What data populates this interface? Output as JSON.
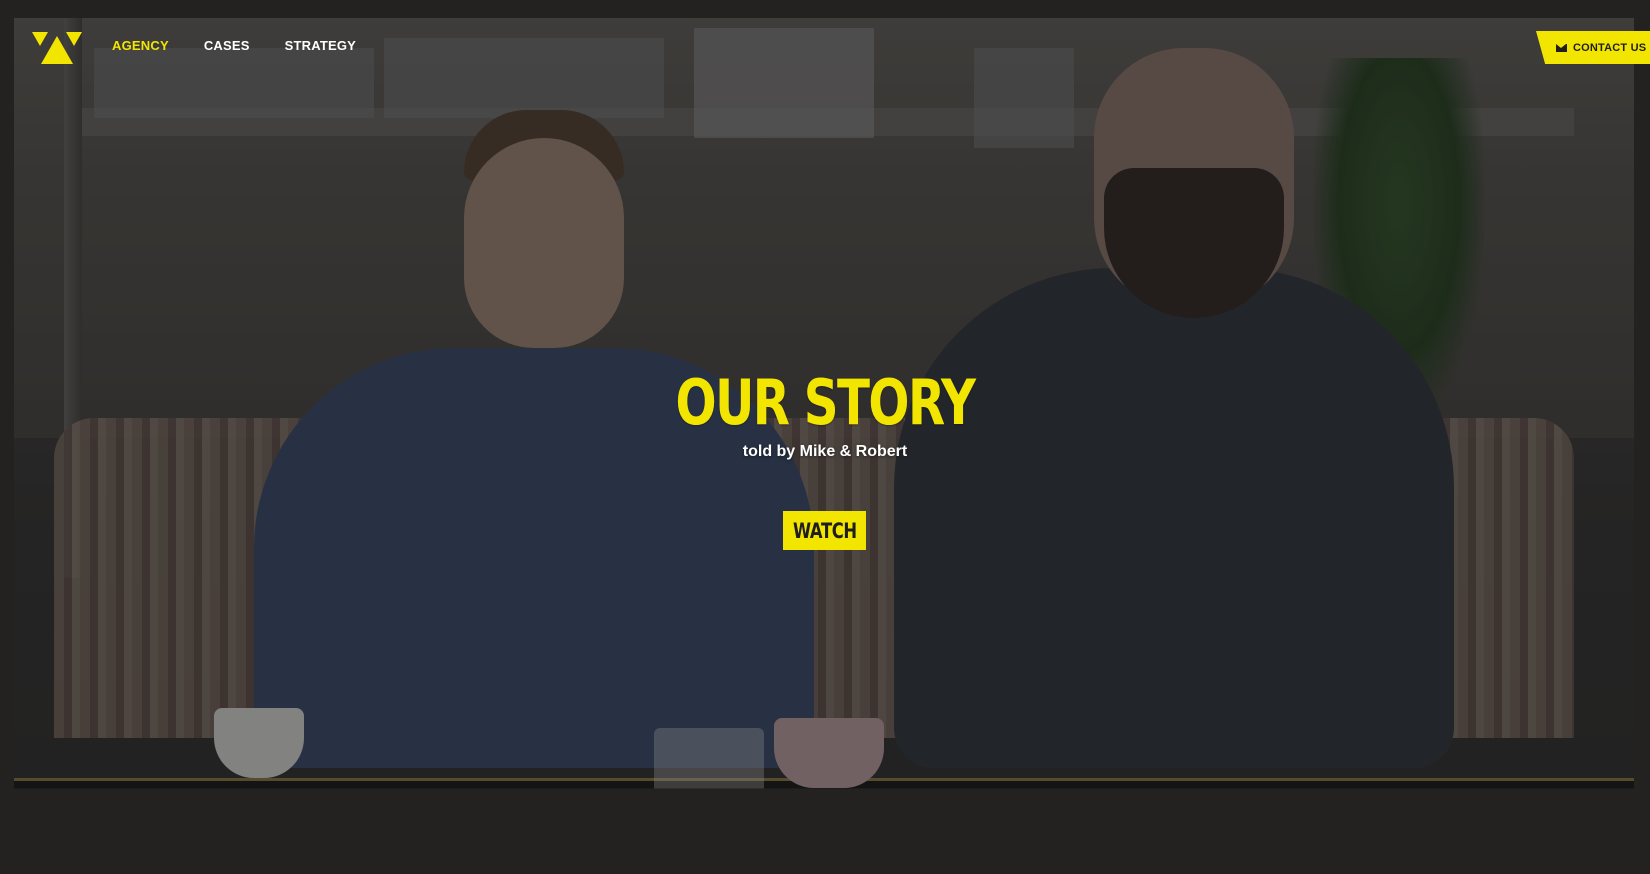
{
  "brand": {
    "logo_icon": "agency-logo-icon",
    "accent_color": "#f2e500",
    "dark_color": "#1f1e1c"
  },
  "nav": {
    "items": [
      {
        "label": "AGENCY",
        "active": true
      },
      {
        "label": "CASES",
        "active": false
      },
      {
        "label": "STRATEGY",
        "active": false
      }
    ]
  },
  "contact": {
    "icon": "mail-icon",
    "label": "CONTACT US"
  },
  "hero": {
    "title": "OUR STORY",
    "subtitle": "told by Mike & Robert",
    "watch_label": "WATCH"
  }
}
